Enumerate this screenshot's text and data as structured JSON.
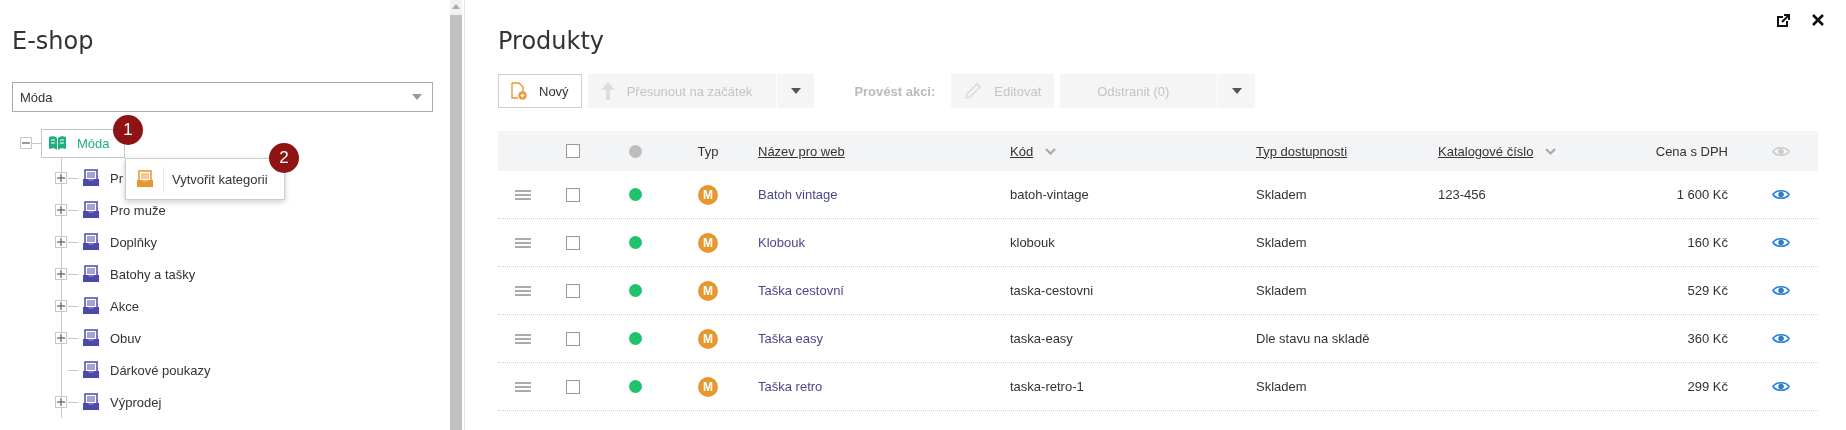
{
  "sidebar": {
    "title": "E-shop",
    "select": {
      "value": "Móda"
    },
    "tree": [
      {
        "label": "Móda",
        "selected": true,
        "expanded": true,
        "children": [
          {
            "label": "Pr",
            "has_children": true
          },
          {
            "label": "Pro muže",
            "has_children": true
          },
          {
            "label": "Doplňky",
            "has_children": true
          },
          {
            "label": "Batohy a tašky",
            "has_children": true
          },
          {
            "label": "Akce",
            "has_children": true
          },
          {
            "label": "Obuv",
            "has_children": true
          },
          {
            "label": "Dárkové poukazy",
            "has_children": false
          },
          {
            "label": "Výprodej",
            "has_children": true
          }
        ]
      }
    ]
  },
  "context_menu": {
    "items": [
      {
        "label": "Vytvořit kategorii"
      }
    ]
  },
  "callouts": [
    "1",
    "2"
  ],
  "main": {
    "title": "Produkty"
  },
  "toolbar": {
    "buttons": [
      {
        "label": "Nový",
        "kind": "new",
        "disabled": false,
        "dropdown": false
      },
      {
        "label": "Přesunout na začátek",
        "kind": "move",
        "disabled": true,
        "dropdown": true
      }
    ],
    "action_label": "Provést akci:",
    "actions": [
      {
        "label": "Editovat",
        "kind": "edit",
        "disabled": true,
        "dropdown": false
      },
      {
        "label": "Odstranit (0)",
        "kind": "delete",
        "disabled": true,
        "dropdown": true
      }
    ]
  },
  "table": {
    "all_selected": false,
    "columns": [
      {
        "label": "Typ",
        "kind": "plain"
      },
      {
        "label": "Název pro web",
        "kind": "link"
      },
      {
        "label": "Kód",
        "kind": "sort"
      },
      {
        "label": "Typ dostupnosti",
        "kind": "link"
      },
      {
        "label": "Katalogové číslo",
        "kind": "sort"
      },
      {
        "label": "Cena s DPH",
        "kind": "plain"
      }
    ],
    "rows": [
      {
        "checked": false,
        "active": true,
        "type": "M",
        "name": "Batoh vintage",
        "code": "batoh-vintage",
        "availability": "Skladem",
        "catalog": "123-456",
        "price": "1 600 Kč"
      },
      {
        "checked": false,
        "active": true,
        "type": "M",
        "name": "Klobouk",
        "code": "klobouk",
        "availability": "Skladem",
        "price": "160 Kč"
      },
      {
        "checked": false,
        "active": true,
        "type": "M",
        "name": "Taška cestovní",
        "code": "taska-cestovni",
        "availability": "Skladem",
        "price": "529 Kč"
      },
      {
        "checked": false,
        "active": true,
        "type": "M",
        "name": "Taška easy",
        "code": "taska-easy",
        "availability": "Dle stavu na skladě",
        "price": "360 Kč"
      },
      {
        "checked": false,
        "active": true,
        "type": "M",
        "name": "Taška retro",
        "code": "taska-retro-1",
        "availability": "Skladem",
        "price": "299 Kč"
      }
    ]
  }
}
